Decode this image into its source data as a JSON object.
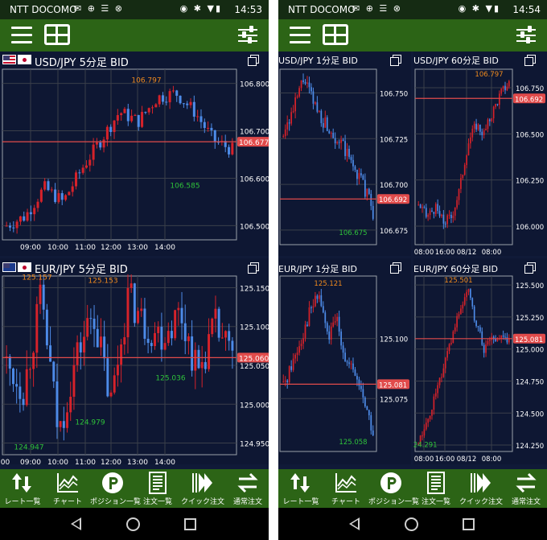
{
  "status_left": {
    "carrier": "NTT DOCOMO",
    "icons": "✉ ⊕ ☰ ⊗",
    "right_icons": "◉ ✱ ▼▮",
    "time": "14:53"
  },
  "status_right": {
    "carrier": "NTT DOCOMO",
    "icons": "✉ ⊕ ☰ ⊗",
    "right_icons": "◉ ✱ ▼▮",
    "time": "14:54"
  },
  "colors": {
    "bull": "#d6222a",
    "bear": "#4d8be8",
    "grid": "#3a3f4a",
    "bid_line": "#e14b4b",
    "high_label": "#ef8a1e",
    "low_label": "#2fc33a",
    "status_bar": "#152b13",
    "toolbar": "#2c6416",
    "background": "#101a38"
  },
  "icons": {
    "menu": "hamburger-icon",
    "layout": "layout-grid-icon",
    "settings": "sliders-icon",
    "copy": "copy-window-icon"
  },
  "charts": {
    "usdjpy_5m": {
      "title": "USD/JPY 5分足 BID",
      "high": "106.797",
      "low": "106.585",
      "price": "106.677",
      "y_ticks": [
        "106.800",
        "106.700",
        "106.600",
        "106.500"
      ],
      "x_ticks": [
        "09:00",
        "10:00",
        "11:00",
        "12:00",
        "13:00",
        "14:00"
      ]
    },
    "eurjpy_5m": {
      "title": "EUR/JPY 5分足 BID",
      "high1": "125.157",
      "high2": "125.153",
      "low1": "124.947",
      "low2": "124.979",
      "low3": "125.036",
      "price": "125.060",
      "y_ticks": [
        "125.150",
        "125.100",
        "125.050",
        "125.000",
        "124.950"
      ],
      "x_ticks": [
        ":00",
        "09:00",
        "10:00",
        "11:00",
        "12:00",
        "13:00",
        "14:00"
      ]
    },
    "usdjpy_1m": {
      "title": "USD/JPY 1分足 BID",
      "low": "106.675",
      "price": "106.692",
      "y_ticks": [
        "106.750",
        "106.725",
        "106.700",
        "106.675"
      ]
    },
    "usdjpy_60m": {
      "title": "USD/JPY 60分足 BID",
      "high": "106.797",
      "price": "106.692",
      "y_ticks": [
        "106.750",
        "106.500",
        "106.250",
        "106.000"
      ],
      "x_ticks": [
        "08:00",
        "16:00",
        "08/12",
        "08:00"
      ]
    },
    "eurjpy_1m": {
      "title": "EUR/JPY 1分足 BID",
      "high": "125.121",
      "low": "125.058",
      "price": "125.081",
      "y_ticks": [
        "125.100",
        "125.075"
      ]
    },
    "eurjpy_60m": {
      "title": "EUR/JPY 60分足 BID",
      "high": "125.501",
      "low": "4.291",
      "price": "125.081",
      "y_ticks": [
        "125.500",
        "125.250",
        "125.000",
        "124.750",
        "124.500",
        "124.250"
      ],
      "x_ticks": [
        "08:00",
        "16:00",
        "08/12",
        "08:00"
      ]
    }
  },
  "nav": {
    "rate": "レート一覧",
    "chart": "チャート",
    "position": "ポジション一覧",
    "order": "注文一覧",
    "quick": "クイック注文",
    "normal": "通常注文"
  }
}
